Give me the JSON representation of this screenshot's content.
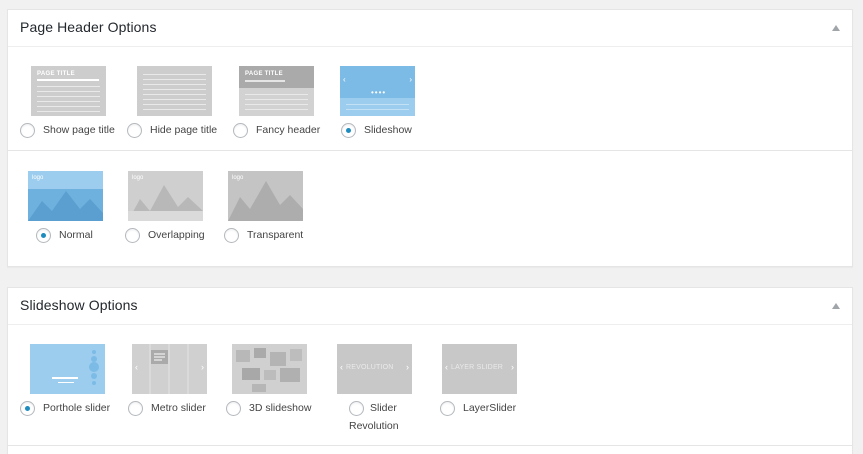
{
  "header_panel": {
    "title": "Page Header Options",
    "page_title_options": [
      {
        "label": "Show page title",
        "selected": false
      },
      {
        "label": "Hide page title",
        "selected": false
      },
      {
        "label": "Fancy header",
        "selected": false
      },
      {
        "label": "Slideshow",
        "selected": true
      }
    ],
    "header_style_options": [
      {
        "label": "Normal",
        "selected": true
      },
      {
        "label": "Overlapping",
        "selected": false
      },
      {
        "label": "Transparent",
        "selected": false
      }
    ],
    "thumb_text": {
      "page_title": "PAGE TITLE",
      "logo": "logo"
    }
  },
  "slideshow_panel": {
    "title": "Slideshow Options",
    "options": [
      {
        "label": "Porthole slider",
        "selected": true
      },
      {
        "label": "Metro slider",
        "selected": false
      },
      {
        "label": "3D slideshow",
        "selected": false
      },
      {
        "label": "Slider Revolution",
        "label_line1": "Slider",
        "label_line2": "Revolution",
        "selected": false
      },
      {
        "label": "LayerSlider",
        "selected": false
      }
    ],
    "thumb_text": {
      "revolution": "REVOLUTION",
      "layerslider": "LAYER SLIDER"
    }
  },
  "colors": {
    "selected_thumb": "#9ccdee",
    "thumb": "#c9c9c9",
    "radio_dot": "#1e8cbe"
  },
  "icons": {
    "collapse": "triangle-up-icon",
    "prev": "chevron-left-icon",
    "next": "chevron-right-icon"
  }
}
